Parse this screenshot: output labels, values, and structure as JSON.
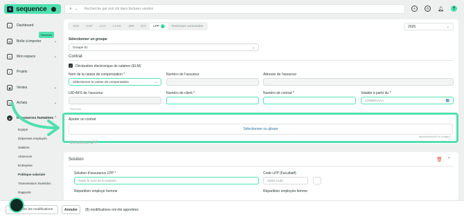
{
  "brand": {
    "name": "sequence"
  },
  "search": {
    "placeholder": "Recherche par mot clé dans factures vendes"
  },
  "sidebar": {
    "items": [
      {
        "label": "Dashboard"
      },
      {
        "label": "Boîte à importer"
      },
      {
        "label": "Mon espace"
      },
      {
        "label": "Projets"
      },
      {
        "label": "Ventes"
      },
      {
        "label": "Achats"
      },
      {
        "label": "Ressources humaines"
      }
    ],
    "new_badge": "Nouveau",
    "sub_items": [
      "Equipe",
      "Dépenses employés",
      "Salaires",
      "Absences",
      "Entreprise",
      "Politique salariale",
      "Transmission Swissdec",
      "Rapports"
    ]
  },
  "tabs": [
    {
      "label": "AVS"
    },
    {
      "label": "CAF"
    },
    {
      "label": "LAA"
    },
    {
      "label": "LAAC"
    },
    {
      "label": "IJM"
    },
    {
      "label": "ICT"
    },
    {
      "label": "LPP",
      "count": "1"
    },
    {
      "label": "Retenues cantonales"
    }
  ],
  "year": "2026",
  "group": {
    "label": "Sélectionner un groupe",
    "value": "Groupe 01"
  },
  "contract": {
    "section_title": "Contrat",
    "elm_label": "Déclaration électronique de salaires (ELM)",
    "caisse_label": "Nom de la caisse de compensation *",
    "caisse_placeholder": "Sélectionner la caisse de compensation",
    "assureur_num_label": "Numéro de l'assureur",
    "assureur_addr_label": "Adresse de l'assureur",
    "uid_label": "UID-BFS de l'assureur",
    "client_num_label": "Numéro de client *",
    "contract_num_label": "Numéro de contrat *",
    "valid_from_label": "Valable à partir du *",
    "valid_from_placeholder": "JJ/MM/AAAA",
    "ghost_checkbox": "Nouveau"
  },
  "upload": {
    "title": "Ajouter un contrat",
    "action": "Sélectionner ou glisser",
    "hint": "application/pdf ou image/*",
    "ghost_title": "Solutions LPP"
  },
  "solution": {
    "title": "Solution",
    "insurance_label": "Solution d'assurance LPP *",
    "insurance_placeholder": "Saisir le nom de la solution",
    "code_label": "Code LPP (Facultatif)",
    "code_placeholder": "Saisir code",
    "split_male_label": "Répartition employé homme",
    "split_female_label": "Répartition employée femme"
  },
  "footer": {
    "save": "Enregistrer les modifications",
    "cancel": "Annuler",
    "modified": "(8) modifications ont été apportées"
  }
}
